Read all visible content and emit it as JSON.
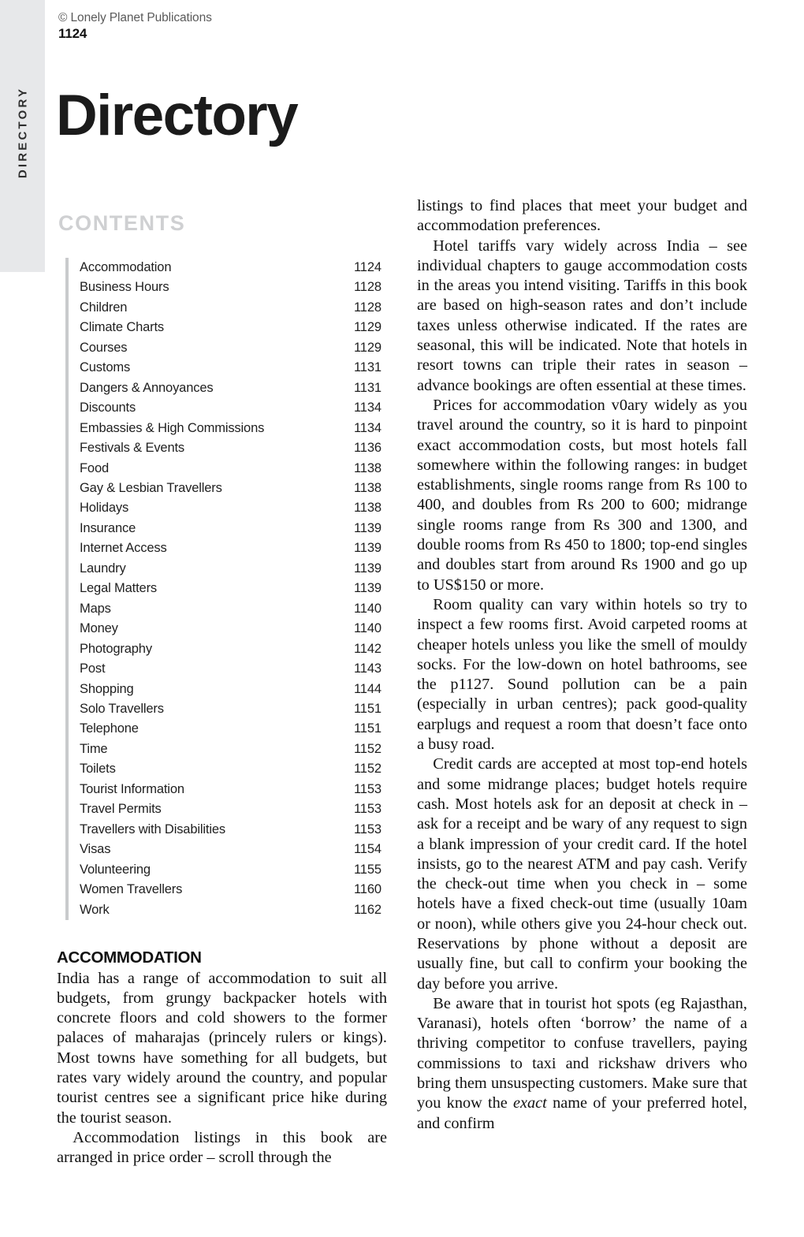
{
  "side_tab": {
    "label": "DIRECTORY"
  },
  "header": {
    "copyright": "© Lonely Planet Publications",
    "folio": "1124"
  },
  "chapter": {
    "title": "Directory"
  },
  "contents": {
    "heading": "CONTENTS",
    "entries": [
      {
        "label": "Accommodation",
        "page": "1124"
      },
      {
        "label": "Business Hours",
        "page": "1128"
      },
      {
        "label": "Children",
        "page": "1128"
      },
      {
        "label": "Climate Charts",
        "page": "1129"
      },
      {
        "label": "Courses",
        "page": "1129"
      },
      {
        "label": "Customs",
        "page": "1131"
      },
      {
        "label": "Dangers & Annoyances",
        "page": "1131"
      },
      {
        "label": "Discounts",
        "page": "1134"
      },
      {
        "label": "Embassies & High Commissions",
        "page": "1134"
      },
      {
        "label": "Festivals & Events",
        "page": "1136"
      },
      {
        "label": "Food",
        "page": "1138"
      },
      {
        "label": "Gay & Lesbian Travellers",
        "page": "1138"
      },
      {
        "label": "Holidays",
        "page": "1138"
      },
      {
        "label": "Insurance",
        "page": "1139"
      },
      {
        "label": "Internet Access",
        "page": "1139"
      },
      {
        "label": "Laundry",
        "page": "1139"
      },
      {
        "label": "Legal Matters",
        "page": "1139"
      },
      {
        "label": "Maps",
        "page": "1140"
      },
      {
        "label": "Money",
        "page": "1140"
      },
      {
        "label": "Photography",
        "page": "1142"
      },
      {
        "label": "Post",
        "page": "1143"
      },
      {
        "label": "Shopping",
        "page": "1144"
      },
      {
        "label": "Solo Travellers",
        "page": "1151"
      },
      {
        "label": "Telephone",
        "page": "1151"
      },
      {
        "label": "Time",
        "page": "1152"
      },
      {
        "label": "Toilets",
        "page": "1152"
      },
      {
        "label": "Tourist Information",
        "page": "1153"
      },
      {
        "label": "Travel Permits",
        "page": "1153"
      },
      {
        "label": "Travellers with Disabilities",
        "page": "1153"
      },
      {
        "label": "Visas",
        "page": "1154"
      },
      {
        "label": "Volunteering",
        "page": "1155"
      },
      {
        "label": "Women Travellers",
        "page": "1160"
      },
      {
        "label": "Work",
        "page": "1162"
      }
    ]
  },
  "left_column": {
    "section_heading": "ACCOMMODATION",
    "paragraphs": [
      "India has a range of accommodation to suit all budgets, from grungy backpacker hotels with concrete floors and cold showers to the former palaces of maharajas (princely rulers or kings). Most towns have something for all budgets, but rates vary widely around the country, and popular tourist centres see a significant price hike during the tourist season.",
      "Accommodation listings in this book are arranged in price order – scroll through the"
    ]
  },
  "right_column": {
    "paragraphs": [
      "listings to find places that meet your budget and accommodation preferences.",
      "Hotel tariffs vary widely across India – see individual chapters to gauge accommodation costs in the areas you intend visiting. Tariffs in this book are based on high-season rates and don’t include taxes unless otherwise indicated. If the rates are seasonal, this will be indicated. Note that hotels in resort towns can triple their rates in season – advance bookings are often essential at these times.",
      "Prices for accommodation v0ary widely as you travel around the country, so it is hard to pinpoint exact accommodation costs, but most hotels fall somewhere within the following ranges: in budget establishments, single rooms range from Rs 100 to 400, and doubles from Rs 200 to 600; midrange single rooms range from Rs 300 and 1300, and double rooms from Rs 450 to 1800; top-end singles and doubles start from around Rs 1900 and go up to US$150 or more.",
      "Room quality can vary within hotels so try to inspect a few rooms first. Avoid carpeted rooms at cheaper hotels unless you like the smell of mouldy socks. For the low-down on hotel bathrooms, see the p1127. Sound pollution can be a pain (especially in urban centres); pack good-quality earplugs and request a room that doesn’t face onto a busy road.",
      "Credit cards are accepted at most top-end hotels and some midrange places; budget hotels require cash. Most hotels ask for an deposit at check in – ask for a receipt and be wary of any request to sign a blank impression of your credit card. If the hotel insists, go to the nearest ATM and pay cash. Verify the check-out time when you check in – some hotels have a fixed check-out time (usually 10am or noon), while others give you 24-hour check out. Reservations by phone without a deposit are usually fine, but call to confirm your booking the day before you arrive."
    ],
    "final_paragraph": {
      "before_italic": "Be aware that in tourist hot spots (eg Rajasthan, Varanasi), hotels often ‘borrow’ the name of a thriving competitor to confuse travellers, paying commissions to taxi and rickshaw drivers who bring them unsuspecting customers. Make sure that you know the ",
      "italic": "exact",
      "after_italic": " name of your preferred hotel, and confirm"
    }
  },
  "colors": {
    "side_tab_background": "#e7e8ea",
    "contents_heading": "#cfd0d2",
    "contents_rule": "#c9cacc",
    "body_text": "#111111",
    "copyright_text": "#5a5a5a"
  }
}
